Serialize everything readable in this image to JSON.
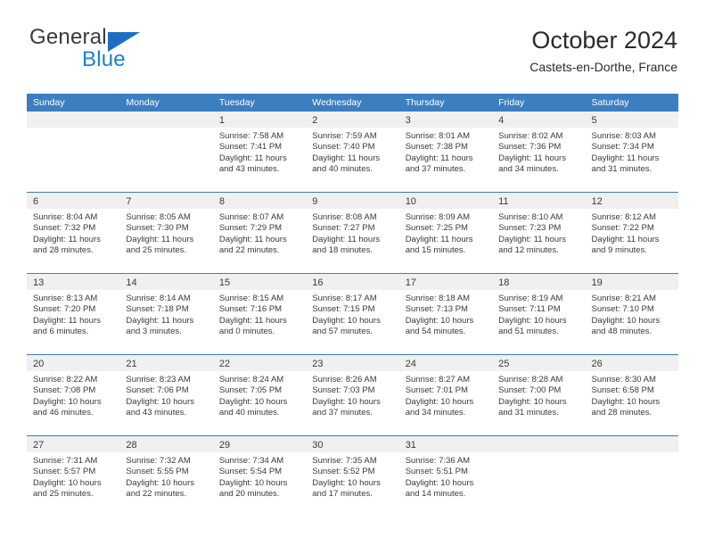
{
  "brand": {
    "name_top": "General",
    "name_bottom": "Blue",
    "accent_color": "#1b7fd4",
    "triangle_color": "#1b6ec2"
  },
  "header": {
    "title": "October 2024",
    "subtitle": "Castets-en-Dorthe, France"
  },
  "theme": {
    "header_row_bg": "#3c7fc0",
    "header_row_text": "#ffffff",
    "day_band_bg": "#f0f0f0",
    "row_divider": "#3c7fc0",
    "body_text": "#3a3a3a"
  },
  "weekdays": [
    "Sunday",
    "Monday",
    "Tuesday",
    "Wednesday",
    "Thursday",
    "Friday",
    "Saturday"
  ],
  "weeks": [
    [
      {
        "day": "",
        "empty": true
      },
      {
        "day": "",
        "empty": true
      },
      {
        "day": "1",
        "sunrise": "Sunrise: 7:58 AM",
        "sunset": "Sunset: 7:41 PM",
        "daylight_1": "Daylight: 11 hours",
        "daylight_2": "and 43 minutes."
      },
      {
        "day": "2",
        "sunrise": "Sunrise: 7:59 AM",
        "sunset": "Sunset: 7:40 PM",
        "daylight_1": "Daylight: 11 hours",
        "daylight_2": "and 40 minutes."
      },
      {
        "day": "3",
        "sunrise": "Sunrise: 8:01 AM",
        "sunset": "Sunset: 7:38 PM",
        "daylight_1": "Daylight: 11 hours",
        "daylight_2": "and 37 minutes."
      },
      {
        "day": "4",
        "sunrise": "Sunrise: 8:02 AM",
        "sunset": "Sunset: 7:36 PM",
        "daylight_1": "Daylight: 11 hours",
        "daylight_2": "and 34 minutes."
      },
      {
        "day": "5",
        "sunrise": "Sunrise: 8:03 AM",
        "sunset": "Sunset: 7:34 PM",
        "daylight_1": "Daylight: 11 hours",
        "daylight_2": "and 31 minutes."
      }
    ],
    [
      {
        "day": "6",
        "sunrise": "Sunrise: 8:04 AM",
        "sunset": "Sunset: 7:32 PM",
        "daylight_1": "Daylight: 11 hours",
        "daylight_2": "and 28 minutes."
      },
      {
        "day": "7",
        "sunrise": "Sunrise: 8:05 AM",
        "sunset": "Sunset: 7:30 PM",
        "daylight_1": "Daylight: 11 hours",
        "daylight_2": "and 25 minutes."
      },
      {
        "day": "8",
        "sunrise": "Sunrise: 8:07 AM",
        "sunset": "Sunset: 7:29 PM",
        "daylight_1": "Daylight: 11 hours",
        "daylight_2": "and 22 minutes."
      },
      {
        "day": "9",
        "sunrise": "Sunrise: 8:08 AM",
        "sunset": "Sunset: 7:27 PM",
        "daylight_1": "Daylight: 11 hours",
        "daylight_2": "and 18 minutes."
      },
      {
        "day": "10",
        "sunrise": "Sunrise: 8:09 AM",
        "sunset": "Sunset: 7:25 PM",
        "daylight_1": "Daylight: 11 hours",
        "daylight_2": "and 15 minutes."
      },
      {
        "day": "11",
        "sunrise": "Sunrise: 8:10 AM",
        "sunset": "Sunset: 7:23 PM",
        "daylight_1": "Daylight: 11 hours",
        "daylight_2": "and 12 minutes."
      },
      {
        "day": "12",
        "sunrise": "Sunrise: 8:12 AM",
        "sunset": "Sunset: 7:22 PM",
        "daylight_1": "Daylight: 11 hours",
        "daylight_2": "and 9 minutes."
      }
    ],
    [
      {
        "day": "13",
        "sunrise": "Sunrise: 8:13 AM",
        "sunset": "Sunset: 7:20 PM",
        "daylight_1": "Daylight: 11 hours",
        "daylight_2": "and 6 minutes."
      },
      {
        "day": "14",
        "sunrise": "Sunrise: 8:14 AM",
        "sunset": "Sunset: 7:18 PM",
        "daylight_1": "Daylight: 11 hours",
        "daylight_2": "and 3 minutes."
      },
      {
        "day": "15",
        "sunrise": "Sunrise: 8:15 AM",
        "sunset": "Sunset: 7:16 PM",
        "daylight_1": "Daylight: 11 hours",
        "daylight_2": "and 0 minutes."
      },
      {
        "day": "16",
        "sunrise": "Sunrise: 8:17 AM",
        "sunset": "Sunset: 7:15 PM",
        "daylight_1": "Daylight: 10 hours",
        "daylight_2": "and 57 minutes."
      },
      {
        "day": "17",
        "sunrise": "Sunrise: 8:18 AM",
        "sunset": "Sunset: 7:13 PM",
        "daylight_1": "Daylight: 10 hours",
        "daylight_2": "and 54 minutes."
      },
      {
        "day": "18",
        "sunrise": "Sunrise: 8:19 AM",
        "sunset": "Sunset: 7:11 PM",
        "daylight_1": "Daylight: 10 hours",
        "daylight_2": "and 51 minutes."
      },
      {
        "day": "19",
        "sunrise": "Sunrise: 8:21 AM",
        "sunset": "Sunset: 7:10 PM",
        "daylight_1": "Daylight: 10 hours",
        "daylight_2": "and 48 minutes."
      }
    ],
    [
      {
        "day": "20",
        "sunrise": "Sunrise: 8:22 AM",
        "sunset": "Sunset: 7:08 PM",
        "daylight_1": "Daylight: 10 hours",
        "daylight_2": "and 46 minutes."
      },
      {
        "day": "21",
        "sunrise": "Sunrise: 8:23 AM",
        "sunset": "Sunset: 7:06 PM",
        "daylight_1": "Daylight: 10 hours",
        "daylight_2": "and 43 minutes."
      },
      {
        "day": "22",
        "sunrise": "Sunrise: 8:24 AM",
        "sunset": "Sunset: 7:05 PM",
        "daylight_1": "Daylight: 10 hours",
        "daylight_2": "and 40 minutes."
      },
      {
        "day": "23",
        "sunrise": "Sunrise: 8:26 AM",
        "sunset": "Sunset: 7:03 PM",
        "daylight_1": "Daylight: 10 hours",
        "daylight_2": "and 37 minutes."
      },
      {
        "day": "24",
        "sunrise": "Sunrise: 8:27 AM",
        "sunset": "Sunset: 7:01 PM",
        "daylight_1": "Daylight: 10 hours",
        "daylight_2": "and 34 minutes."
      },
      {
        "day": "25",
        "sunrise": "Sunrise: 8:28 AM",
        "sunset": "Sunset: 7:00 PM",
        "daylight_1": "Daylight: 10 hours",
        "daylight_2": "and 31 minutes."
      },
      {
        "day": "26",
        "sunrise": "Sunrise: 8:30 AM",
        "sunset": "Sunset: 6:58 PM",
        "daylight_1": "Daylight: 10 hours",
        "daylight_2": "and 28 minutes."
      }
    ],
    [
      {
        "day": "27",
        "sunrise": "Sunrise: 7:31 AM",
        "sunset": "Sunset: 5:57 PM",
        "daylight_1": "Daylight: 10 hours",
        "daylight_2": "and 25 minutes."
      },
      {
        "day": "28",
        "sunrise": "Sunrise: 7:32 AM",
        "sunset": "Sunset: 5:55 PM",
        "daylight_1": "Daylight: 10 hours",
        "daylight_2": "and 22 minutes."
      },
      {
        "day": "29",
        "sunrise": "Sunrise: 7:34 AM",
        "sunset": "Sunset: 5:54 PM",
        "daylight_1": "Daylight: 10 hours",
        "daylight_2": "and 20 minutes."
      },
      {
        "day": "30",
        "sunrise": "Sunrise: 7:35 AM",
        "sunset": "Sunset: 5:52 PM",
        "daylight_1": "Daylight: 10 hours",
        "daylight_2": "and 17 minutes."
      },
      {
        "day": "31",
        "sunrise": "Sunrise: 7:36 AM",
        "sunset": "Sunset: 5:51 PM",
        "daylight_1": "Daylight: 10 hours",
        "daylight_2": "and 14 minutes."
      },
      {
        "day": "",
        "empty": true
      },
      {
        "day": "",
        "empty": true
      }
    ]
  ]
}
